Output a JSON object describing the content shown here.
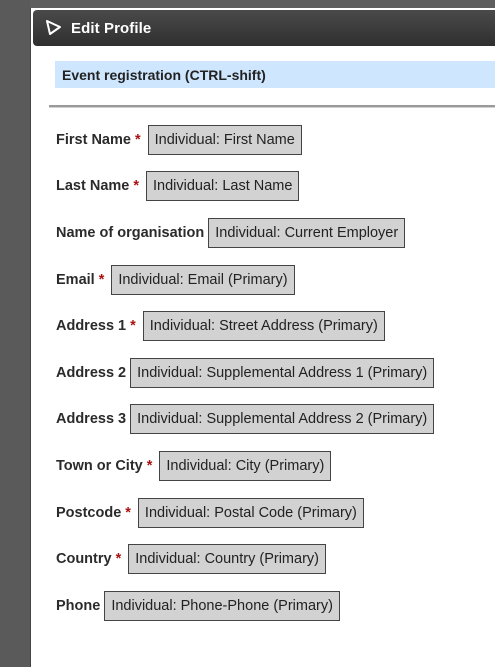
{
  "dialog": {
    "title": "Edit Profile",
    "banner": "Event registration (CTRL-shift)"
  },
  "fields": [
    {
      "label": "First Name",
      "required": "*",
      "token": "Individual: First Name"
    },
    {
      "label": "Last Name",
      "required": "*",
      "token": "Individual: Last Name"
    },
    {
      "label": "Name of organisation",
      "required": "",
      "token": "Individual: Current Employer"
    },
    {
      "label": "Email",
      "required": "*",
      "token": "Individual: Email (Primary)"
    },
    {
      "label": "Address 1",
      "required": "*",
      "token": "Individual: Street Address (Primary)"
    },
    {
      "label": "Address 2",
      "required": "",
      "token": "Individual: Supplemental Address 1 (Primary)"
    },
    {
      "label": "Address 3",
      "required": "",
      "token": "Individual: Supplemental Address 2 (Primary)"
    },
    {
      "label": "Town or City",
      "required": "*",
      "token": "Individual: City (Primary)"
    },
    {
      "label": "Postcode",
      "required": "*",
      "token": "Individual: Postal Code (Primary)"
    },
    {
      "label": "Country",
      "required": "*",
      "token": "Individual: Country (Primary)"
    },
    {
      "label": "Phone",
      "required": "",
      "token": "Individual: Phone-Phone (Primary)"
    }
  ],
  "colors": {
    "titlebar": "#3a3a3a",
    "banner": "#cfe6ff",
    "required": "#aa1111",
    "token_bg": "#d2d2d2"
  },
  "icons": {
    "title": "pencil-edit-icon"
  }
}
